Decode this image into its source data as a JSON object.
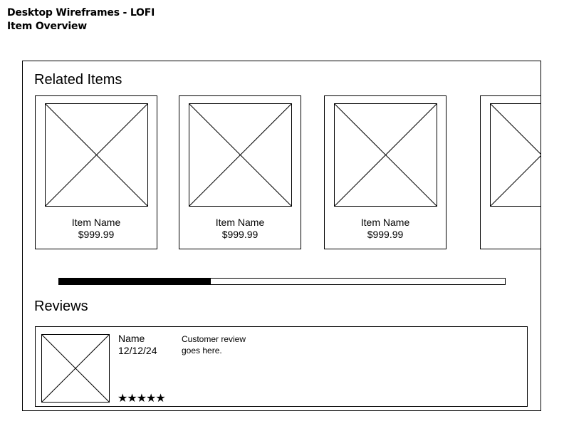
{
  "header": {
    "title": "Desktop Wireframes - LOFI",
    "subtitle": "Item Overview"
  },
  "related": {
    "title": "Related Items",
    "items": [
      {
        "name": "Item Name",
        "price": "$999.99"
      },
      {
        "name": "Item Name",
        "price": "$999.99"
      },
      {
        "name": "Item Name",
        "price": "$999.99"
      },
      {
        "name": "",
        "price": ""
      }
    ],
    "scroll_progress": 0.34
  },
  "reviews": {
    "title": "Reviews",
    "items": [
      {
        "name": "Name",
        "date": "12/12/24",
        "text": "Customer review goes here.",
        "rating": "★★★★★"
      }
    ]
  }
}
